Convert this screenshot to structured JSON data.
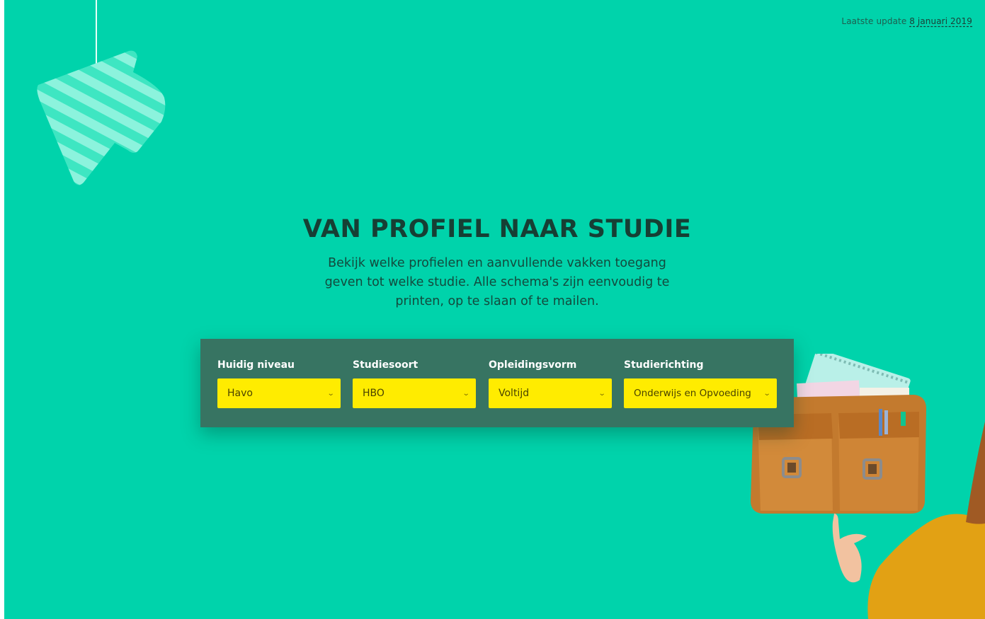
{
  "update": {
    "prefix": "Laatste update",
    "date": "8 januari 2019"
  },
  "hero": {
    "title": "VAN PROFIEL NAAR STUDIE",
    "subtitle_lines": [
      "Bekijk welke profielen en aanvullende vakken toegang",
      "geven tot welke studie. Alle schema's zijn eenvoudig te",
      "printen, op te slaan of te mailen."
    ]
  },
  "filters": [
    {
      "label": "Huidig niveau",
      "value": "Havo"
    },
    {
      "label": "Studiesoort",
      "value": "HBO"
    },
    {
      "label": "Opleidingsvorm",
      "value": "Voltijd"
    },
    {
      "label": "Studierichting",
      "value": "Onderwijs en Opvoeding"
    }
  ],
  "icons": {
    "dropdown": "chevron-down-icon",
    "decoration": "striped-arrow-icon"
  },
  "colors": {
    "background": "#00d3ab",
    "panel": "#377462",
    "select": "#ffec00",
    "title": "#163f34"
  }
}
